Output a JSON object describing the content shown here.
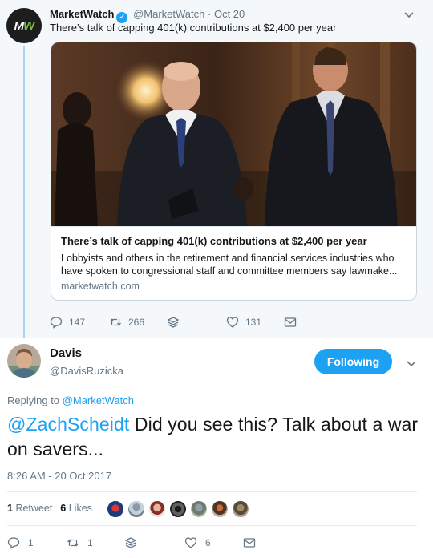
{
  "quoted_tweet": {
    "author_name": "MarketWatch",
    "handle": "@MarketWatch",
    "separator": "·",
    "date": "Oct 20",
    "text": "There’s talk of capping 401(k) contributions at $2,400 per year",
    "avatar_logo": "MW",
    "card": {
      "title": "There’s talk of capping 401(k) contributions at $2,400 per year",
      "description": "Lobbyists and others in the retirement and financial services industries who have spoken to congressional staff and committee members say lawmake...",
      "domain": "marketwatch.com"
    },
    "actions": {
      "reply_count": "147",
      "retweet_count": "266",
      "like_count": "131"
    }
  },
  "main_tweet": {
    "author_name": "Davis",
    "handle": "@DavisRuzicka",
    "follow_label": "Following",
    "replying_prefix": "Replying to",
    "replying_to": "@MarketWatch",
    "mention": "@ZachScheidt",
    "text_rest": " Did you see this? Talk about a war on savers...",
    "timestamp": "8:26 AM - 20 Oct 2017",
    "retweets_count": "1",
    "retweets_label": "Retweet",
    "likes_count": "6",
    "likes_label": "Likes",
    "actions": {
      "reply_count": "1",
      "retweet_count": "1",
      "like_count": "6"
    }
  },
  "colors": {
    "accent": "#1da1f2",
    "muted_text": "#657786",
    "thread_line": "#a6d4f2",
    "parent_background": "#f5f8fa",
    "marketwatch_green": "#7fc241"
  },
  "icons": [
    "verified-badge-icon",
    "chevron-down-icon",
    "reply-icon",
    "retweet-icon",
    "stack-icon",
    "heart-icon",
    "message-icon"
  ]
}
